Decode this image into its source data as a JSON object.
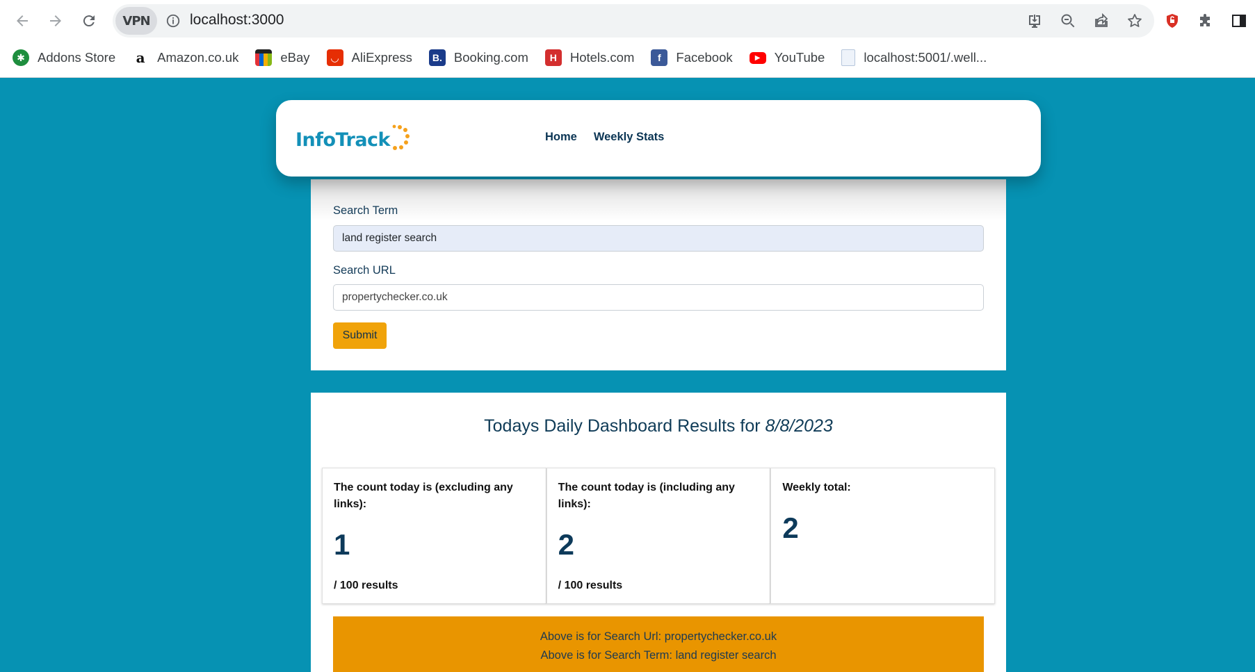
{
  "browser": {
    "url": "localhost:3000",
    "vpn_label": "VPN",
    "bookmarks": [
      {
        "label": "Addons Store",
        "icon": "addons-store-icon",
        "color": "#1e8e3e"
      },
      {
        "label": "Amazon.co.uk",
        "icon": "amazon-icon",
        "color": "#ffffff"
      },
      {
        "label": "eBay",
        "icon": "ebay-icon",
        "color": "#ffffff"
      },
      {
        "label": "AliExpress",
        "icon": "aliexpress-icon",
        "color": "#e62e04"
      },
      {
        "label": "Booking.com",
        "icon": "booking-icon",
        "color": "#1a3b8a"
      },
      {
        "label": "Hotels.com",
        "icon": "hotels-icon",
        "color": "#d32f2f"
      },
      {
        "label": "Facebook",
        "icon": "facebook-icon",
        "color": "#1877f2"
      },
      {
        "label": "YouTube",
        "icon": "youtube-icon",
        "color": "#ff0000"
      },
      {
        "label": "localhost:5001/.well...",
        "icon": "document-icon",
        "color": "#c9d7ea"
      }
    ]
  },
  "navbar": {
    "logo_text": "InfoTrack",
    "links": [
      {
        "label": "Home"
      },
      {
        "label": "Weekly Stats"
      }
    ]
  },
  "form": {
    "search_term_label": "Search Term",
    "search_term_value": "land register search",
    "search_url_label": "Search URL",
    "search_url_value": "propertychecker.co.uk",
    "submit_label": "Submit"
  },
  "dashboard": {
    "title_prefix": "Todays Daily Dashboard Results for ",
    "title_date": "8/8/2023",
    "stats": [
      {
        "label": "The count today is (excluding any links):",
        "value": "1",
        "sub": "/ 100 results"
      },
      {
        "label": "The count today is (including any links):",
        "value": "2",
        "sub": "/ 100 results"
      },
      {
        "label": "Weekly total:",
        "value": "2",
        "sub": ""
      }
    ],
    "summary_url": "Above is for Search Url: propertychecker.co.uk",
    "summary_term": "Above is for Search Term: land register search"
  },
  "colors": {
    "page_background": "#0692b3",
    "accent_orange": "#f0a30a",
    "summary_orange": "#e99500",
    "navy_text": "#0d3a5a"
  }
}
